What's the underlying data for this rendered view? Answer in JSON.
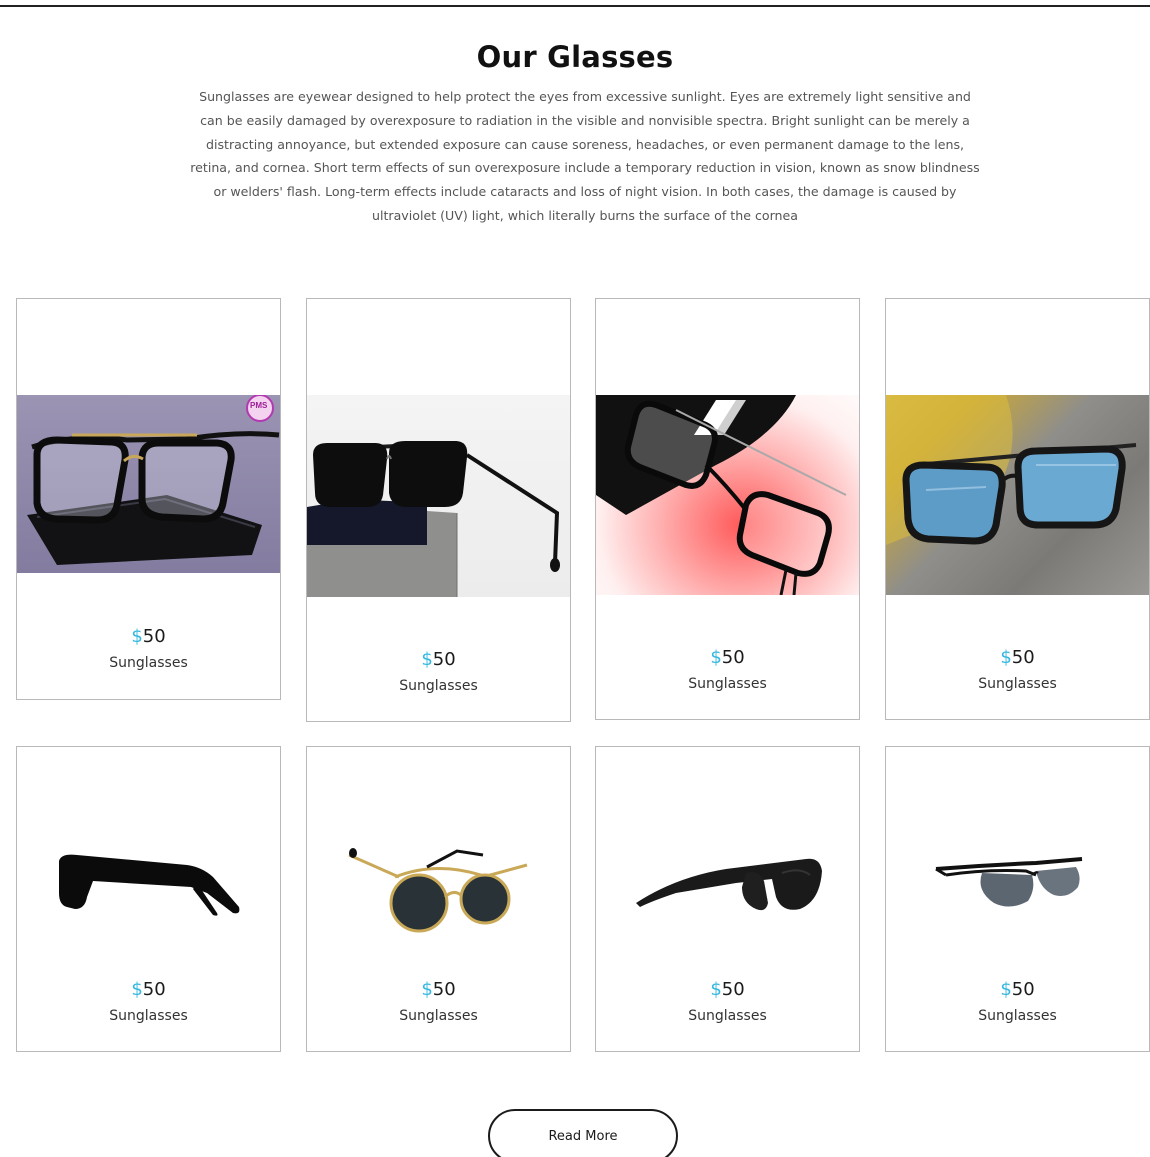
{
  "section": {
    "title": "Our Glasses",
    "description": "Sunglasses are eyewear designed to help protect the eyes from excessive sunlight. Eyes are extremely light sensitive and can be easily damaged by overexposure to radiation in the visible and nonvisible spectra. Bright sunlight can be merely a distracting annoyance, but extended exposure can cause soreness, headaches, or even permanent damage to the lens, retina, and cornea. Short term effects of sun overexposure include a temporary reduction in vision, known as snow blindness or welders' flash. Long-term effects include cataracts and loss of night vision. In both cases, the damage is caused by ultraviolet (UV) light, which literally burns the surface of the cornea"
  },
  "products": [
    {
      "currency": "$",
      "price": "50",
      "name": "Sunglasses",
      "badge": "PMS",
      "icon": "aviator-glasses-on-phone"
    },
    {
      "currency": "$",
      "price": "50",
      "name": "Sunglasses",
      "icon": "square-black-sunglasses"
    },
    {
      "currency": "$",
      "price": "50",
      "name": "Sunglasses",
      "icon": "black-frame-glasses-on-pink"
    },
    {
      "currency": "$",
      "price": "50",
      "name": "Sunglasses",
      "icon": "blue-lens-sunglasses-on-asphalt"
    },
    {
      "currency": "$",
      "price": "50",
      "name": "Sunglasses",
      "icon": "black-sunglasses-side-view"
    },
    {
      "currency": "$",
      "price": "50",
      "name": "Sunglasses",
      "icon": "round-gold-sunglasses"
    },
    {
      "currency": "$",
      "price": "50",
      "name": "Sunglasses",
      "icon": "sport-black-sunglasses"
    },
    {
      "currency": "$",
      "price": "50",
      "name": "Sunglasses",
      "icon": "rimless-sport-sunglasses"
    }
  ],
  "read_more_label": "Read More",
  "colors": {
    "accent": "#34b7e0",
    "border": "#b9b9b9",
    "text": "#1b1b1b"
  }
}
